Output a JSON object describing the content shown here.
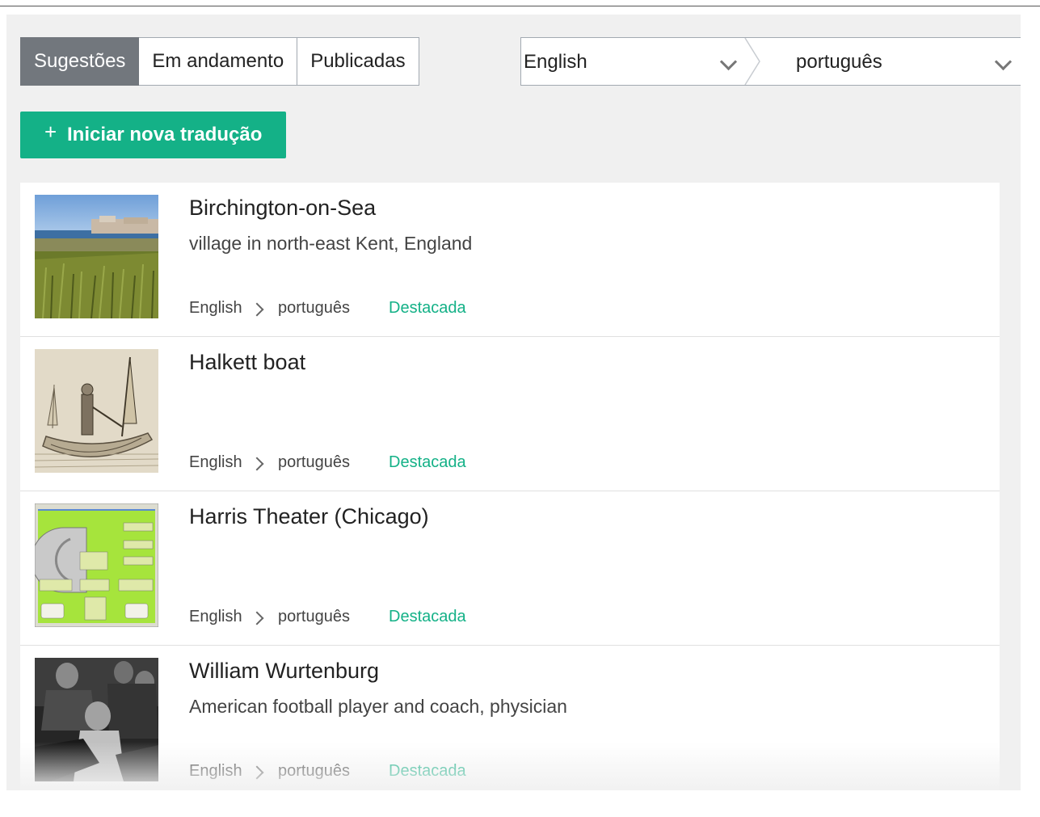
{
  "tabs": [
    {
      "label": "Sugestões",
      "active": true
    },
    {
      "label": "Em andamento",
      "active": false
    },
    {
      "label": "Publicadas",
      "active": false
    }
  ],
  "language_selector": {
    "source": "English",
    "target": "português"
  },
  "start_button": {
    "icon": "plus-icon",
    "label": "Iniciar nova tradução"
  },
  "suggestions": [
    {
      "title": "Birchington-on-Sea",
      "description": "village in north-east Kent, England",
      "source_lang": "English",
      "target_lang": "português",
      "badge": "Destacada",
      "thumbnail": "coastal-village-photo"
    },
    {
      "title": "Halkett boat",
      "description": "",
      "source_lang": "English",
      "target_lang": "português",
      "badge": "Destacada",
      "thumbnail": "boat-sketch"
    },
    {
      "title": "Harris Theater (Chicago)",
      "description": "",
      "source_lang": "English",
      "target_lang": "português",
      "badge": "Destacada",
      "thumbnail": "theater-map"
    },
    {
      "title": "William Wurtenburg",
      "description": "American football player and coach, physician",
      "source_lang": "English",
      "target_lang": "português",
      "badge": "Destacada",
      "thumbnail": "bw-portrait-photo"
    }
  ],
  "colors": {
    "accent": "#14b187",
    "active_tab": "#72777d",
    "panel_bg": "#f0f0f0"
  }
}
